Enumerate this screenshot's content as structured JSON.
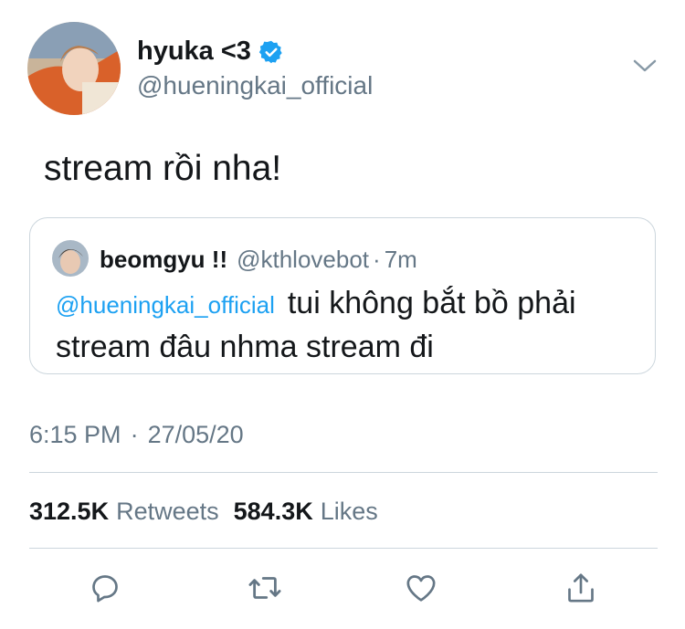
{
  "tweet": {
    "display_name": "hyuka <3",
    "handle": "@hueningkai_official",
    "text": "stream rồi nha!",
    "verified": true
  },
  "quote": {
    "display_name": "beomgyu !!",
    "handle": "@kthlovebot",
    "separator": "·",
    "time": "7m",
    "mention": "@hueningkai_official",
    "text_line1": "tui không bắt bồ phải",
    "text_line2": "stream đâu nhma stream đi"
  },
  "meta": {
    "time": "6:15 PM",
    "separator": "·",
    "date": "27/05/20"
  },
  "stats": {
    "retweets_count": "312.5K",
    "retweets_label": "Retweets",
    "likes_count": "584.3K",
    "likes_label": "Likes"
  },
  "colors": {
    "link": "#1da1f2",
    "secondary_text": "#657786",
    "divider": "#ccd6dd",
    "verified_badge": "#1da1f2"
  },
  "icons": [
    "verified-badge-icon",
    "chevron-down-icon",
    "reply-icon",
    "retweet-icon",
    "like-icon",
    "share-icon"
  ]
}
